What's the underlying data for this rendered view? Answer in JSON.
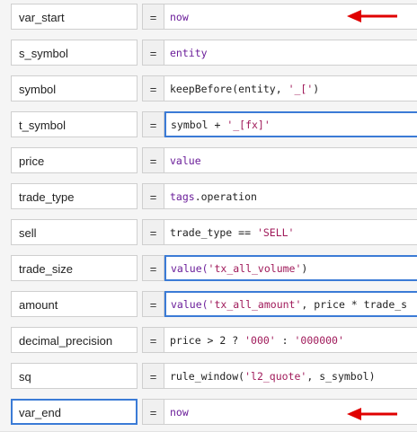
{
  "rows": [
    {
      "name": "var_start",
      "op": "=",
      "expr": [
        {
          "t": "now",
          "c": "fn"
        }
      ]
    },
    {
      "name": "s_symbol",
      "op": "=",
      "expr": [
        {
          "t": "entity",
          "c": "fn"
        }
      ]
    },
    {
      "name": "symbol",
      "op": "=",
      "expr": [
        {
          "t": "keepBefore(entity, ",
          "c": "id"
        },
        {
          "t": "'_['",
          "c": "str"
        },
        {
          "t": ")",
          "c": "id"
        }
      ]
    },
    {
      "name": "t_symbol",
      "op": "=",
      "expr": [
        {
          "t": "symbol + ",
          "c": "id"
        },
        {
          "t": "'_[fx]'",
          "c": "str"
        }
      ]
    },
    {
      "name": "price",
      "op": "=",
      "expr": [
        {
          "t": "value",
          "c": "fn"
        }
      ]
    },
    {
      "name": "trade_type",
      "op": "=",
      "expr": [
        {
          "t": "tags",
          "c": "fn"
        },
        {
          "t": ".operation",
          "c": "id"
        }
      ]
    },
    {
      "name": "sell",
      "op": "=",
      "expr": [
        {
          "t": "trade_type == ",
          "c": "id"
        },
        {
          "t": "'SELL'",
          "c": "str"
        }
      ]
    },
    {
      "name": "trade_size",
      "op": "=",
      "expr": [
        {
          "t": "value(",
          "c": "fn"
        },
        {
          "t": "'tx_all_volume'",
          "c": "str"
        },
        {
          "t": ")",
          "c": "id"
        }
      ]
    },
    {
      "name": "amount",
      "op": "=",
      "expr": [
        {
          "t": "value(",
          "c": "fn"
        },
        {
          "t": "'tx_all_amount'",
          "c": "str"
        },
        {
          "t": ", price * trade_s",
          "c": "id"
        }
      ]
    },
    {
      "name": "decimal_precision",
      "op": "=",
      "expr": [
        {
          "t": "price > 2 ? ",
          "c": "id"
        },
        {
          "t": "'000'",
          "c": "str"
        },
        {
          "t": " : ",
          "c": "id"
        },
        {
          "t": "'000000'",
          "c": "str"
        }
      ]
    },
    {
      "name": "sq",
      "op": "=",
      "expr": [
        {
          "t": "rule_window(",
          "c": "id"
        },
        {
          "t": "'l2_quote'",
          "c": "str"
        },
        {
          "t": ", s_symbol)",
          "c": "id"
        }
      ]
    },
    {
      "name": "var_end",
      "op": "=",
      "expr": [
        {
          "t": "now",
          "c": "fn"
        }
      ]
    }
  ],
  "colors": {
    "accent": "#3b7bd6",
    "arrow": "#e00000",
    "string": "#a01a5a",
    "function": "#6b1e9a"
  }
}
